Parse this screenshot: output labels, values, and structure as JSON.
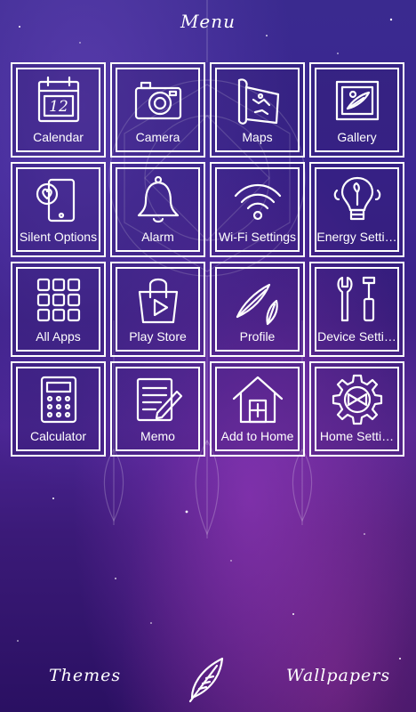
{
  "header": {
    "title": "Menu"
  },
  "apps": [
    {
      "label": "Calendar",
      "icon": "calendar-icon",
      "name": "tile-calendar"
    },
    {
      "label": "Camera",
      "icon": "camera-icon",
      "name": "tile-camera"
    },
    {
      "label": "Maps",
      "icon": "map-icon",
      "name": "tile-maps"
    },
    {
      "label": "Gallery",
      "icon": "picture-frame-icon",
      "name": "tile-gallery"
    },
    {
      "label": "Silent Options",
      "icon": "phone-heart-icon",
      "name": "tile-silent-options"
    },
    {
      "label": "Alarm",
      "icon": "bell-icon",
      "name": "tile-alarm"
    },
    {
      "label": "Wi-Fi Settings",
      "icon": "wifi-icon",
      "name": "tile-wifi-settings"
    },
    {
      "label": "Energy Setti…",
      "icon": "lightbulb-icon",
      "name": "tile-energy-settings"
    },
    {
      "label": "All Apps",
      "icon": "app-grid-icon",
      "name": "tile-all-apps"
    },
    {
      "label": "Play Store",
      "icon": "shopping-bag-play-icon",
      "name": "tile-play-store"
    },
    {
      "label": "Profile",
      "icon": "feathers-icon",
      "name": "tile-profile"
    },
    {
      "label": "Device Setti…",
      "icon": "tools-icon",
      "name": "tile-device-settings"
    },
    {
      "label": "Calculator",
      "icon": "calculator-icon",
      "name": "tile-calculator"
    },
    {
      "label": "Memo",
      "icon": "notepad-pencil-icon",
      "name": "tile-memo"
    },
    {
      "label": "Add to Home",
      "icon": "house-plus-icon",
      "name": "tile-add-to-home"
    },
    {
      "label": "Home Setti…",
      "icon": "gear-bow-icon",
      "name": "tile-home-settings"
    }
  ],
  "calendar_day": "12",
  "bottom": {
    "left_label": "Themes",
    "center_icon": "feather-icon",
    "right_label": "Wallpapers"
  },
  "colors": {
    "line": "#ffffff",
    "bg_top": "#3a2a8f",
    "bg_bottom": "#2a1062"
  }
}
